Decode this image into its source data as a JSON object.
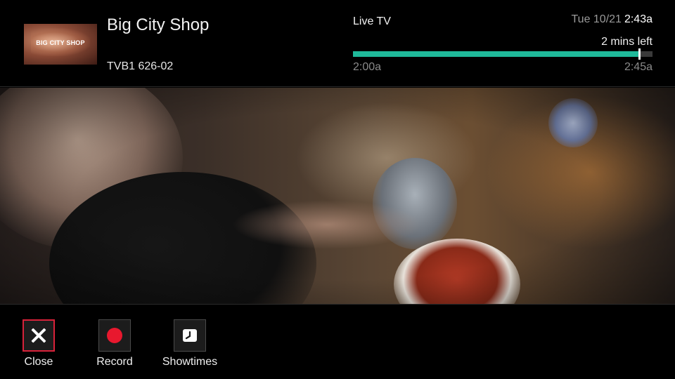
{
  "program": {
    "thumbnail_text": "BIG CITY SHOP",
    "title": "Big City Shop",
    "channel": "TVB1 626-02"
  },
  "status": {
    "mode": "Live TV",
    "date": "Tue 10/21",
    "time": "2:43a",
    "time_left": "2 mins left",
    "start_time": "2:00a",
    "end_time": "2:45a",
    "progress_fraction": 0.955,
    "progress_color": "#1fb99a"
  },
  "actions": {
    "close_label": "Close",
    "record_label": "Record",
    "showtimes_label": "Showtimes",
    "selected": "Close",
    "selection_color": "#d8223a",
    "record_color": "#e8182e"
  },
  "icons": {
    "close": "close-icon",
    "record": "record-icon",
    "showtimes": "clock-icon"
  }
}
